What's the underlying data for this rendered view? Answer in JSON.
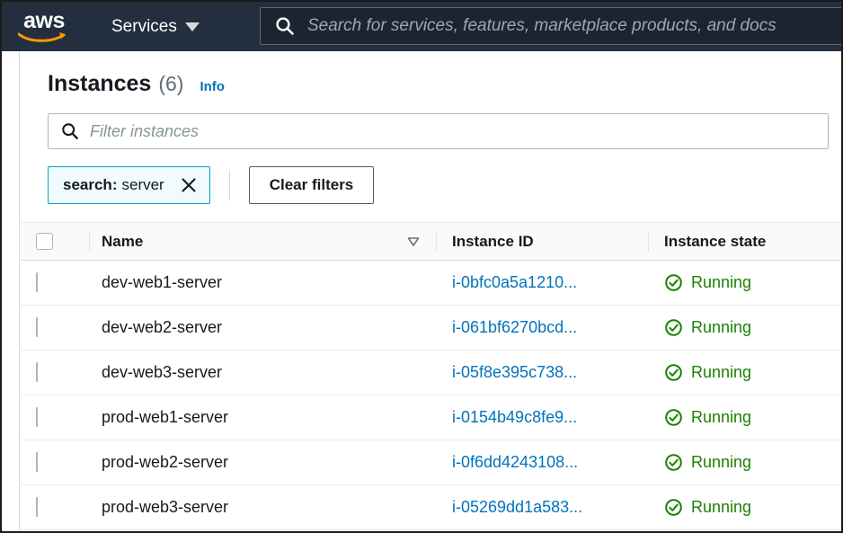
{
  "topnav": {
    "logo_alt": "aws",
    "services_label": "Services",
    "search_placeholder": "Search for services, features, marketplace products, and docs"
  },
  "header": {
    "title": "Instances",
    "count": "(6)",
    "info_label": "Info"
  },
  "filter": {
    "placeholder": "Filter instances",
    "token_key": "search:",
    "token_value": "server",
    "clear_label": "Clear filters"
  },
  "table": {
    "columns": [
      "Name",
      "Instance ID",
      "Instance state"
    ],
    "sort_column": "Name",
    "sort_direction": "descending",
    "rows": [
      {
        "name": "dev-web1-server",
        "instance_id": "i-0bfc0a5a1210...",
        "state": "Running"
      },
      {
        "name": "dev-web2-server",
        "instance_id": "i-061bf6270bcd...",
        "state": "Running"
      },
      {
        "name": "dev-web3-server",
        "instance_id": "i-05f8e395c738...",
        "state": "Running"
      },
      {
        "name": "prod-web1-server",
        "instance_id": "i-0154b49c8fe9...",
        "state": "Running"
      },
      {
        "name": "prod-web2-server",
        "instance_id": "i-0f6dd4243108...",
        "state": "Running"
      },
      {
        "name": "prod-web3-server",
        "instance_id": "i-05269dd1a583...",
        "state": "Running"
      }
    ]
  },
  "colors": {
    "nav_background": "#232f3e",
    "link": "#0073bb",
    "running_green": "#1d8102",
    "token_border": "#00a1c9",
    "token_background": "#f1faff",
    "logo_orange": "#ff9900"
  }
}
